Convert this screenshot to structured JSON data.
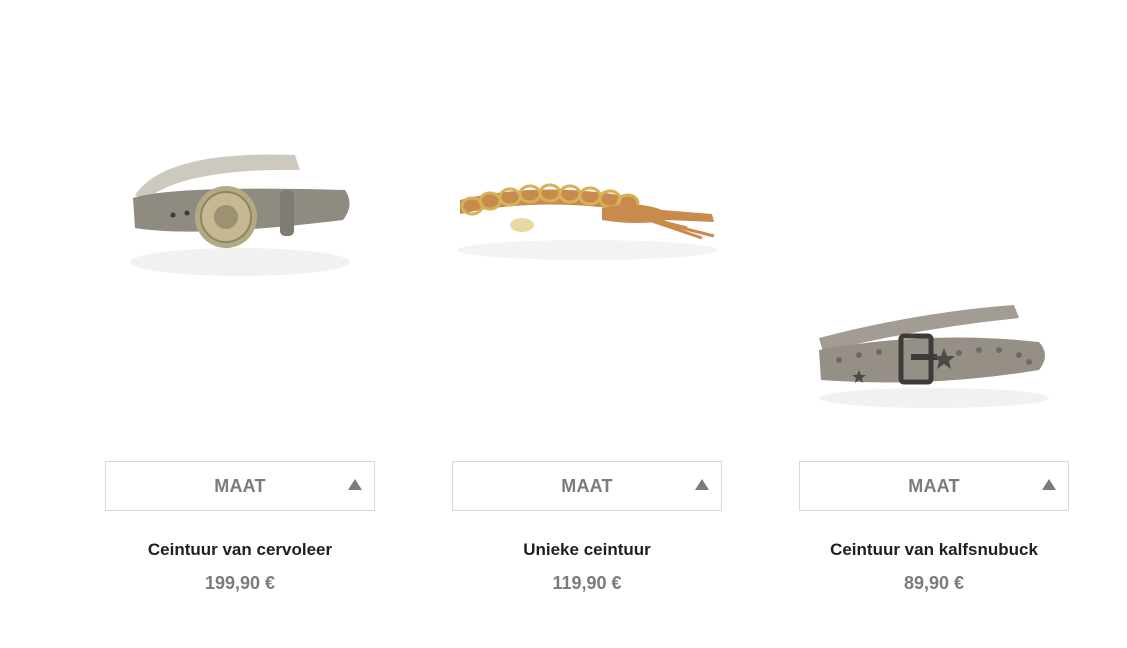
{
  "size_select_label": "MAAT",
  "colors": {
    "label_gray": "#7b7b7b",
    "name_dark": "#1f1f1f",
    "border": "#d9d9d9"
  },
  "products": [
    {
      "name": "Ceintuur van cervoleer",
      "price": "199,90 €",
      "image": "taupe-leather-belt-with-round-medallion-buckle"
    },
    {
      "name": "Unieke ceintuur",
      "price": "119,90 €",
      "image": "tan-leather-and-gold-chain-belt-with-tassel"
    },
    {
      "name": "Ceintuur van kalfsnubuck",
      "price": "89,90 €",
      "image": "grey-nubuck-belt-with-studs-and-stars"
    }
  ]
}
